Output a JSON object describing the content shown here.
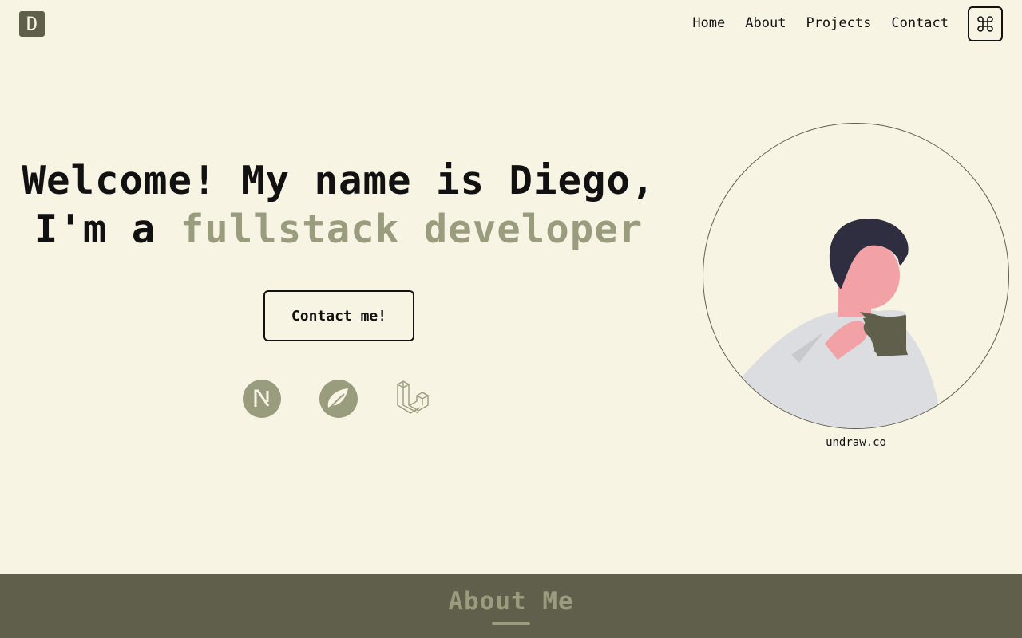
{
  "logo": {
    "letter": "D"
  },
  "nav": {
    "items": [
      {
        "label": "Home"
      },
      {
        "label": "About"
      },
      {
        "label": "Projects"
      },
      {
        "label": "Contact"
      }
    ],
    "command_icon": "command-key-icon"
  },
  "hero": {
    "line1": "Welcome! My name is Diego,",
    "line2_prefix": "I'm a ",
    "line2_accent": "fullstack developer",
    "cta_label": "Contact me!",
    "tech_icons": [
      "nextjs-icon",
      "spring-icon",
      "laravel-icon"
    ]
  },
  "illustration": {
    "credit": "undraw.co"
  },
  "about": {
    "title": "About Me"
  },
  "colors": {
    "background": "#f8f4e3",
    "accent": "#9a9c7e",
    "dark": "#5f5f4b",
    "text": "#111111"
  }
}
